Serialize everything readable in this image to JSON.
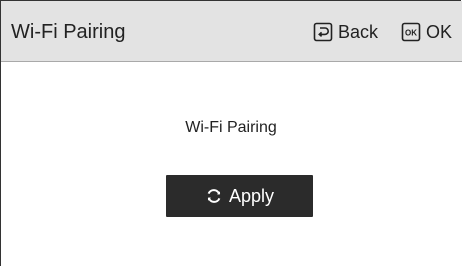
{
  "header": {
    "title": "Wi-Fi Pairing",
    "back_label": "Back",
    "ok_label": "OK",
    "ok_key_text": "OK"
  },
  "content": {
    "label": "Wi-Fi Pairing",
    "apply_label": "Apply"
  },
  "icons": {
    "back": "back-key-icon",
    "ok": "ok-key-icon",
    "apply": "refresh-icon"
  },
  "colors": {
    "header_bg": "#e3e3e3",
    "button_bg": "#2b2b2b",
    "button_text": "#ffffff"
  }
}
